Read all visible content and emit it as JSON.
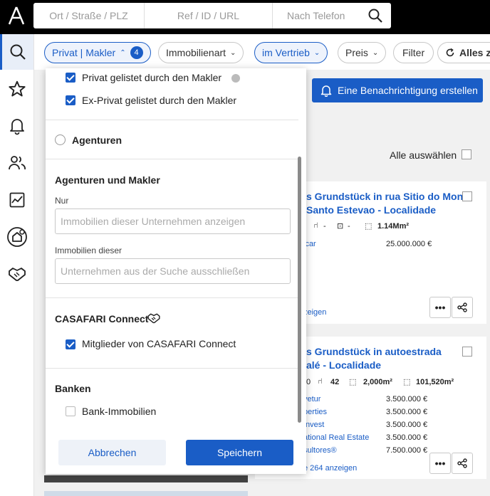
{
  "topbar": {
    "logo_icon": "casafari-logo-icon",
    "search_location_placeholder": "Ort / Straße / PLZ",
    "search_ref_placeholder": "Ref / ID / URL",
    "search_phone_placeholder": "Nach Telefon",
    "search_icon": "search-icon"
  },
  "sidebar": {
    "items": [
      {
        "name": "search",
        "icon": "search-icon"
      },
      {
        "name": "favorites",
        "icon": "star-icon"
      },
      {
        "name": "alerts",
        "icon": "bell-icon"
      },
      {
        "name": "contacts",
        "icon": "people-icon"
      },
      {
        "name": "analytics",
        "icon": "chart-icon"
      },
      {
        "name": "properties",
        "icon": "home-icon"
      },
      {
        "name": "connect",
        "icon": "handshake-icon"
      }
    ]
  },
  "filters": {
    "private_agent": "Privat | Makler",
    "private_agent_count": "4",
    "property_type": "Immobilienart",
    "on_sale": "im Vertrieb",
    "price": "Preis",
    "filter": "Filter",
    "reset_all": "Alles zu"
  },
  "main": {
    "notify_button": "Eine Benachrichtigung erstellen",
    "select_all": "Alle auswählen",
    "cards": [
      {
        "title_line1": "s Grundstück in rua Sitio do Monte",
        "title_line2": "Santo Estevao - Localidade",
        "meta": [
          "-",
          "-",
          "1.14Mm²"
        ],
        "rows": [
          {
            "agency": "lcar",
            "price": "25.000.000 €"
          }
        ],
        "more_link": "zeigen"
      },
      {
        "title_line1": "s Grundstück in autoestrada",
        "title_line2": "alé - Localidade",
        "meta": [
          "0",
          "42",
          "2,000m²",
          "101,520m²"
        ],
        "rows": [
          {
            "agency": "vetur",
            "price": "3.500.000 €"
          },
          {
            "agency": "perties",
            "price": "3.500.000 €"
          },
          {
            "agency": "Invest",
            "price": "3.500.000 €"
          },
          {
            "agency": "ational Real Estate",
            "price": "3.500.000 €"
          },
          {
            "agency": "sultores®",
            "price": "7.500.000 €"
          }
        ],
        "more_link": "e 264 anzeigen"
      }
    ]
  },
  "panel": {
    "cut_option": "Privat gelistet durch den Makler",
    "ex_private": "Ex-Privat gelistet durch den Makler",
    "agencies_radio": "Agenturen",
    "agencies_section": "Agenturen und Makler",
    "only_label": "Nur",
    "only_placeholder": "Immobilien dieser Unternehmen anzeigen",
    "exclude_label": "Immobilien dieser",
    "exclude_placeholder": "Unternehmen aus der Suche ausschließen",
    "connect_section": "CASAFARI Connect",
    "connect_members": "Mitglieder von CASAFARI Connect",
    "banks_section": "Banken",
    "bank_properties": "Bank-Immobilien",
    "cancel": "Abbrechen",
    "save": "Speichern"
  },
  "colors": {
    "accent": "#1a5dc6",
    "topbar": "#000000"
  }
}
